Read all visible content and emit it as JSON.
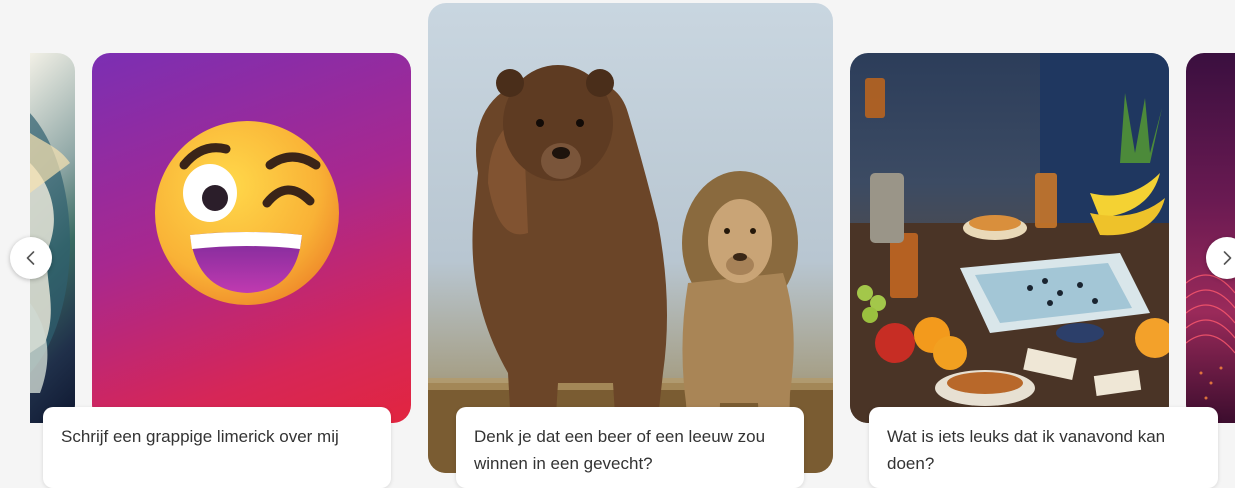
{
  "carousel": {
    "cards": [
      {
        "caption": "Schrijf een grappige limerick over mij"
      },
      {
        "caption": "Denk je dat een beer of een leeuw zou winnen in een gevecht?"
      },
      {
        "caption": "Wat is iets leuks dat ik vanavond kan doen?"
      }
    ],
    "prev_icon": "chevron-left-icon",
    "next_icon": "chevron-right-icon"
  },
  "colors": {
    "page_background": "#f5f5f5",
    "caption_background": "#ffffff",
    "caption_text": "#333333"
  }
}
